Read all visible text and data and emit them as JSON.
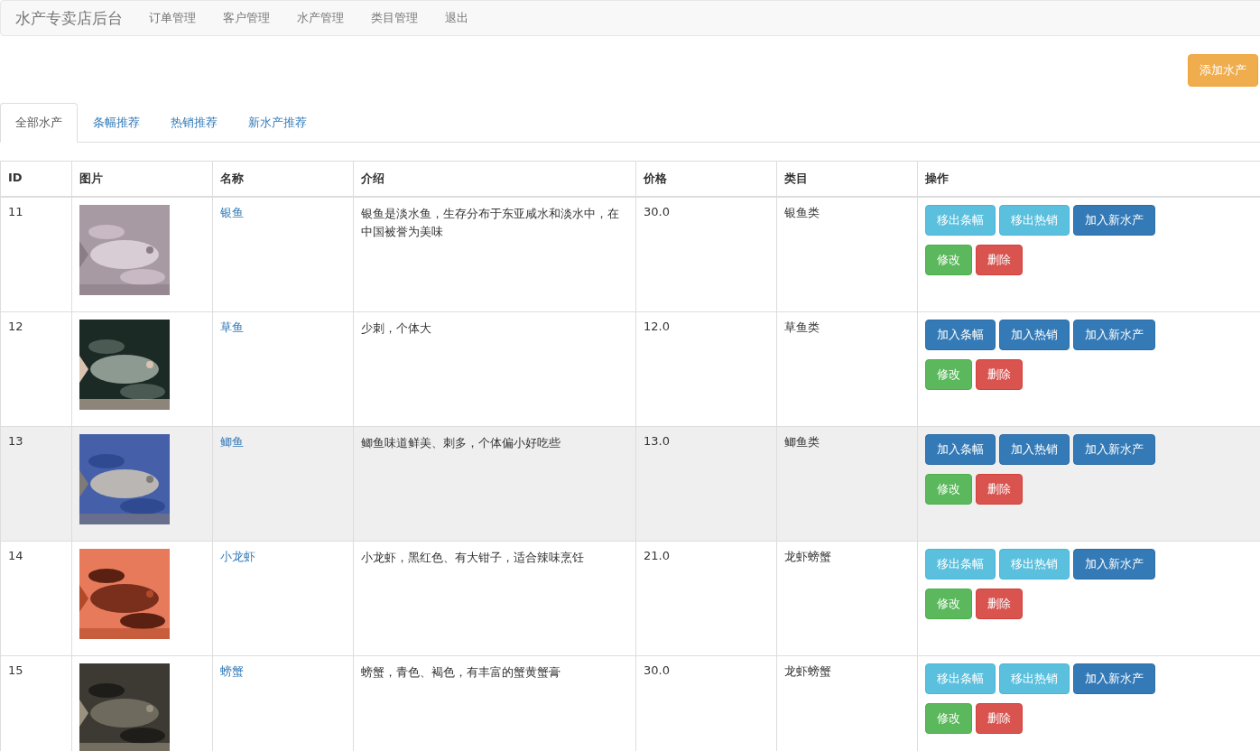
{
  "navbar": {
    "brand": "水产专卖店后台",
    "items": [
      "订单管理",
      "客户管理",
      "水产管理",
      "类目管理",
      "退出"
    ]
  },
  "add_button": "添加水产",
  "tabs": [
    {
      "label": "全部水产",
      "selected": true
    },
    {
      "label": "条幅推荐",
      "selected": false
    },
    {
      "label": "热销推荐",
      "selected": false
    },
    {
      "label": "新水产推荐",
      "selected": false
    }
  ],
  "table": {
    "columns": [
      "ID",
      "图片",
      "名称",
      "介绍",
      "价格",
      "类目",
      "操作"
    ],
    "rows": [
      {
        "id": "11",
        "name": "银鱼",
        "intro": "银鱼是淡水鱼，生存分布于东亚咸水和淡水中，在中国被誉为美味",
        "price": "30.0",
        "category": "银鱼类",
        "selected": false,
        "actions": [
          {
            "label": "移出条幅",
            "kind": "info"
          },
          {
            "label": "移出热销",
            "kind": "info"
          },
          {
            "label": "加入新水产",
            "kind": "primary"
          },
          {
            "label": "修改",
            "kind": "success"
          },
          {
            "label": "删除",
            "kind": "danger"
          }
        ]
      },
      {
        "id": "12",
        "name": "草鱼",
        "intro": "少刺，个体大",
        "price": "12.0",
        "category": "草鱼类",
        "selected": false,
        "actions": [
          {
            "label": "加入条幅",
            "kind": "primary"
          },
          {
            "label": "加入热销",
            "kind": "primary"
          },
          {
            "label": "加入新水产",
            "kind": "primary"
          },
          {
            "label": "修改",
            "kind": "success"
          },
          {
            "label": "删除",
            "kind": "danger"
          }
        ]
      },
      {
        "id": "13",
        "name": "鲫鱼",
        "intro": "鲫鱼味道鲜美、刺多，个体偏小好吃些",
        "price": "13.0",
        "category": "鲫鱼类",
        "selected": true,
        "actions": [
          {
            "label": "加入条幅",
            "kind": "primary"
          },
          {
            "label": "加入热销",
            "kind": "primary"
          },
          {
            "label": "加入新水产",
            "kind": "primary"
          },
          {
            "label": "修改",
            "kind": "success"
          },
          {
            "label": "删除",
            "kind": "danger"
          }
        ]
      },
      {
        "id": "14",
        "name": "小龙虾",
        "intro": "小龙虾，黑红色、有大钳子，适合辣味烹饪",
        "price": "21.0",
        "category": "龙虾螃蟹",
        "selected": false,
        "actions": [
          {
            "label": "移出条幅",
            "kind": "info"
          },
          {
            "label": "移出热销",
            "kind": "info"
          },
          {
            "label": "加入新水产",
            "kind": "primary"
          },
          {
            "label": "修改",
            "kind": "success"
          },
          {
            "label": "删除",
            "kind": "danger"
          }
        ]
      },
      {
        "id": "15",
        "name": "螃蟹",
        "intro": "螃蟹，青色、褐色，有丰富的蟹黄蟹膏",
        "price": "30.0",
        "category": "龙虾螃蟹",
        "selected": false,
        "actions": [
          {
            "label": "移出条幅",
            "kind": "info"
          },
          {
            "label": "移出热销",
            "kind": "info"
          },
          {
            "label": "加入新水产",
            "kind": "primary"
          },
          {
            "label": "修改",
            "kind": "success"
          },
          {
            "label": "删除",
            "kind": "danger"
          }
        ]
      }
    ]
  }
}
